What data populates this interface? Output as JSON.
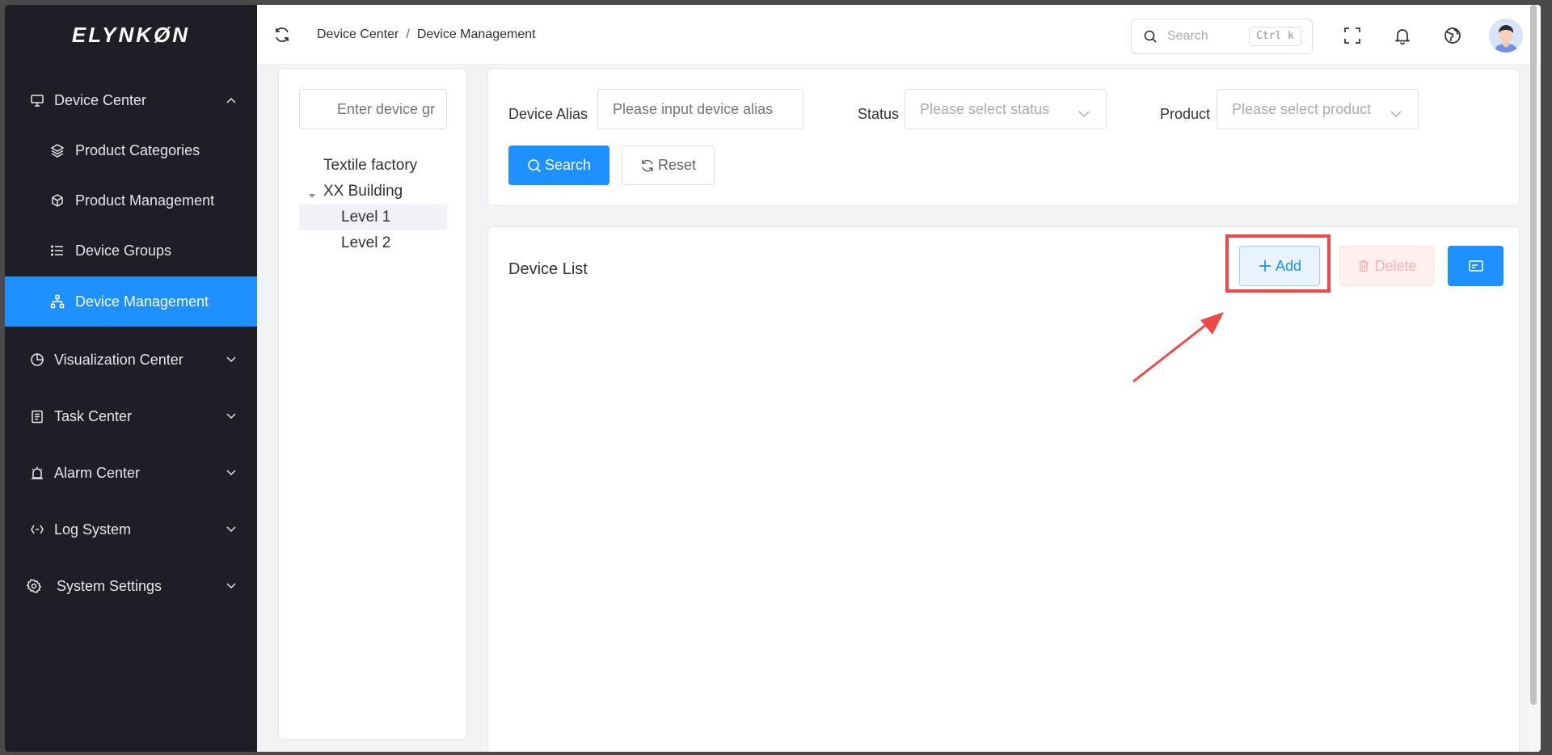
{
  "app": {
    "logo_text": "ELYNKØN"
  },
  "sidebar": {
    "groups": [
      {
        "label": "Device Center",
        "icon": "monitor-icon",
        "expanded": true
      },
      {
        "label": "Visualization Center",
        "icon": "pie-chart-icon"
      },
      {
        "label": "Task Center",
        "icon": "clipboard-icon"
      },
      {
        "label": "Alarm Center",
        "icon": "alarm-icon"
      },
      {
        "label": "Log System",
        "icon": "code-icon"
      },
      {
        "label": "System Settings",
        "icon": "gear-icon"
      }
    ],
    "sub_items": [
      {
        "label": "Product Categories",
        "icon": "layers-icon"
      },
      {
        "label": "Product Management",
        "icon": "cube-icon"
      },
      {
        "label": "Device Groups",
        "icon": "list-icon"
      },
      {
        "label": "Device Management",
        "icon": "org-chart-icon",
        "active": true
      }
    ]
  },
  "header": {
    "breadcrumb": [
      "Device Center",
      "Device Management"
    ],
    "breadcrumb_separator": "/",
    "search_placeholder": "Search",
    "search_shortcut": "Ctrl k"
  },
  "tree": {
    "filter_placeholder": "Enter device gr",
    "nodes": [
      "Textile factory",
      "XX Building",
      "Level 1",
      "Level 2"
    ],
    "selected": "Level 1"
  },
  "filters": {
    "alias_label": "Device Alias",
    "alias_placeholder": "Please input device alias",
    "status_label": "Status",
    "status_placeholder": "Please select status",
    "product_label": "Product",
    "product_placeholder": "Please select product",
    "search_button": "Search",
    "reset_button": "Reset"
  },
  "list": {
    "title": "Device List",
    "add_button": "Add",
    "delete_button": "Delete"
  },
  "colors": {
    "primary": "#1e90ff",
    "sidebar_bg": "#1d1e26",
    "highlight": "#f04848"
  }
}
